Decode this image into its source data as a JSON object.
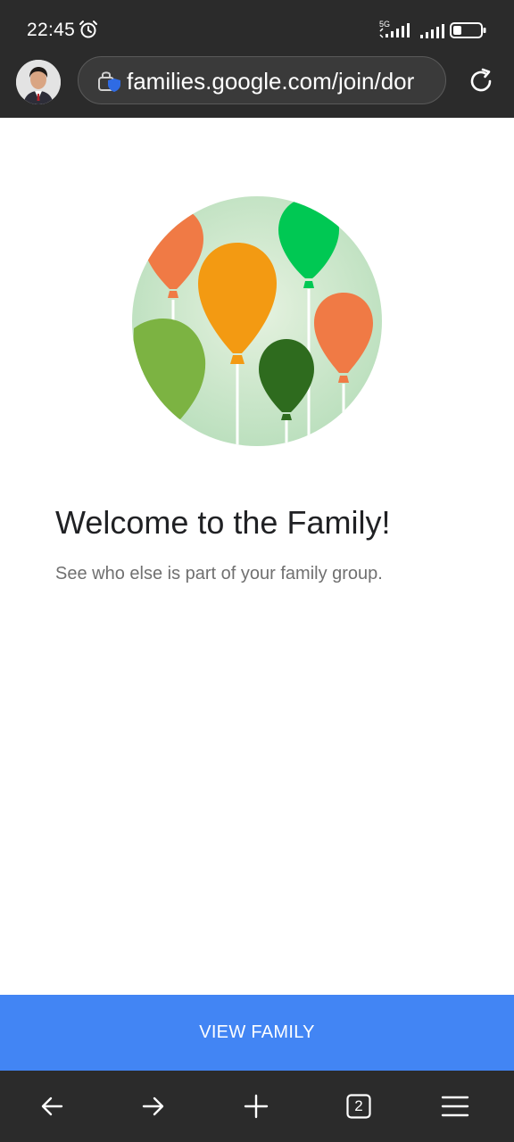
{
  "status_bar": {
    "time": "22:45",
    "network_label": "5G"
  },
  "browser": {
    "url": "families.google.com/join/dor",
    "tab_count": "2"
  },
  "page": {
    "title": "Welcome to the Family!",
    "subtitle": "See who else is part of your family group.",
    "cta_label": "VIEW FAMILY"
  },
  "icons": {
    "alarm": "alarm-icon",
    "lock": "lock-shield-icon",
    "reload": "reload-icon",
    "back": "arrow-left-icon",
    "forward": "arrow-right-icon",
    "new_tab": "plus-icon",
    "tabs": "tabs-icon",
    "menu": "hamburger-menu-icon"
  },
  "colors": {
    "chrome_bg": "#2b2b2b",
    "cta_blue": "#4285f4",
    "title": "#202124",
    "subtitle": "#707070"
  }
}
